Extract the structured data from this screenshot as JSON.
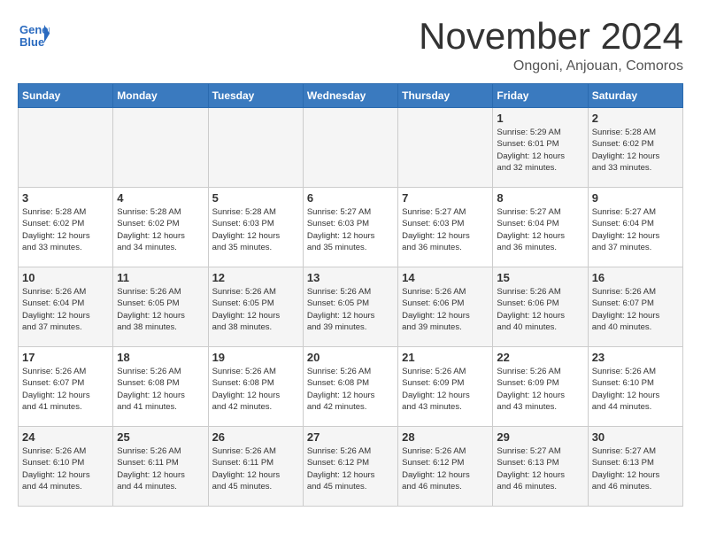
{
  "header": {
    "logo_line1": "General",
    "logo_line2": "Blue",
    "month": "November 2024",
    "location": "Ongoni, Anjouan, Comoros"
  },
  "weekdays": [
    "Sunday",
    "Monday",
    "Tuesday",
    "Wednesday",
    "Thursday",
    "Friday",
    "Saturday"
  ],
  "weeks": [
    [
      {
        "day": "",
        "info": ""
      },
      {
        "day": "",
        "info": ""
      },
      {
        "day": "",
        "info": ""
      },
      {
        "day": "",
        "info": ""
      },
      {
        "day": "",
        "info": ""
      },
      {
        "day": "1",
        "info": "Sunrise: 5:29 AM\nSunset: 6:01 PM\nDaylight: 12 hours\nand 32 minutes."
      },
      {
        "day": "2",
        "info": "Sunrise: 5:28 AM\nSunset: 6:02 PM\nDaylight: 12 hours\nand 33 minutes."
      }
    ],
    [
      {
        "day": "3",
        "info": "Sunrise: 5:28 AM\nSunset: 6:02 PM\nDaylight: 12 hours\nand 33 minutes."
      },
      {
        "day": "4",
        "info": "Sunrise: 5:28 AM\nSunset: 6:02 PM\nDaylight: 12 hours\nand 34 minutes."
      },
      {
        "day": "5",
        "info": "Sunrise: 5:28 AM\nSunset: 6:03 PM\nDaylight: 12 hours\nand 35 minutes."
      },
      {
        "day": "6",
        "info": "Sunrise: 5:27 AM\nSunset: 6:03 PM\nDaylight: 12 hours\nand 35 minutes."
      },
      {
        "day": "7",
        "info": "Sunrise: 5:27 AM\nSunset: 6:03 PM\nDaylight: 12 hours\nand 36 minutes."
      },
      {
        "day": "8",
        "info": "Sunrise: 5:27 AM\nSunset: 6:04 PM\nDaylight: 12 hours\nand 36 minutes."
      },
      {
        "day": "9",
        "info": "Sunrise: 5:27 AM\nSunset: 6:04 PM\nDaylight: 12 hours\nand 37 minutes."
      }
    ],
    [
      {
        "day": "10",
        "info": "Sunrise: 5:26 AM\nSunset: 6:04 PM\nDaylight: 12 hours\nand 37 minutes."
      },
      {
        "day": "11",
        "info": "Sunrise: 5:26 AM\nSunset: 6:05 PM\nDaylight: 12 hours\nand 38 minutes."
      },
      {
        "day": "12",
        "info": "Sunrise: 5:26 AM\nSunset: 6:05 PM\nDaylight: 12 hours\nand 38 minutes."
      },
      {
        "day": "13",
        "info": "Sunrise: 5:26 AM\nSunset: 6:05 PM\nDaylight: 12 hours\nand 39 minutes."
      },
      {
        "day": "14",
        "info": "Sunrise: 5:26 AM\nSunset: 6:06 PM\nDaylight: 12 hours\nand 39 minutes."
      },
      {
        "day": "15",
        "info": "Sunrise: 5:26 AM\nSunset: 6:06 PM\nDaylight: 12 hours\nand 40 minutes."
      },
      {
        "day": "16",
        "info": "Sunrise: 5:26 AM\nSunset: 6:07 PM\nDaylight: 12 hours\nand 40 minutes."
      }
    ],
    [
      {
        "day": "17",
        "info": "Sunrise: 5:26 AM\nSunset: 6:07 PM\nDaylight: 12 hours\nand 41 minutes."
      },
      {
        "day": "18",
        "info": "Sunrise: 5:26 AM\nSunset: 6:08 PM\nDaylight: 12 hours\nand 41 minutes."
      },
      {
        "day": "19",
        "info": "Sunrise: 5:26 AM\nSunset: 6:08 PM\nDaylight: 12 hours\nand 42 minutes."
      },
      {
        "day": "20",
        "info": "Sunrise: 5:26 AM\nSunset: 6:08 PM\nDaylight: 12 hours\nand 42 minutes."
      },
      {
        "day": "21",
        "info": "Sunrise: 5:26 AM\nSunset: 6:09 PM\nDaylight: 12 hours\nand 43 minutes."
      },
      {
        "day": "22",
        "info": "Sunrise: 5:26 AM\nSunset: 6:09 PM\nDaylight: 12 hours\nand 43 minutes."
      },
      {
        "day": "23",
        "info": "Sunrise: 5:26 AM\nSunset: 6:10 PM\nDaylight: 12 hours\nand 44 minutes."
      }
    ],
    [
      {
        "day": "24",
        "info": "Sunrise: 5:26 AM\nSunset: 6:10 PM\nDaylight: 12 hours\nand 44 minutes."
      },
      {
        "day": "25",
        "info": "Sunrise: 5:26 AM\nSunset: 6:11 PM\nDaylight: 12 hours\nand 44 minutes."
      },
      {
        "day": "26",
        "info": "Sunrise: 5:26 AM\nSunset: 6:11 PM\nDaylight: 12 hours\nand 45 minutes."
      },
      {
        "day": "27",
        "info": "Sunrise: 5:26 AM\nSunset: 6:12 PM\nDaylight: 12 hours\nand 45 minutes."
      },
      {
        "day": "28",
        "info": "Sunrise: 5:26 AM\nSunset: 6:12 PM\nDaylight: 12 hours\nand 46 minutes."
      },
      {
        "day": "29",
        "info": "Sunrise: 5:27 AM\nSunset: 6:13 PM\nDaylight: 12 hours\nand 46 minutes."
      },
      {
        "day": "30",
        "info": "Sunrise: 5:27 AM\nSunset: 6:13 PM\nDaylight: 12 hours\nand 46 minutes."
      }
    ]
  ]
}
